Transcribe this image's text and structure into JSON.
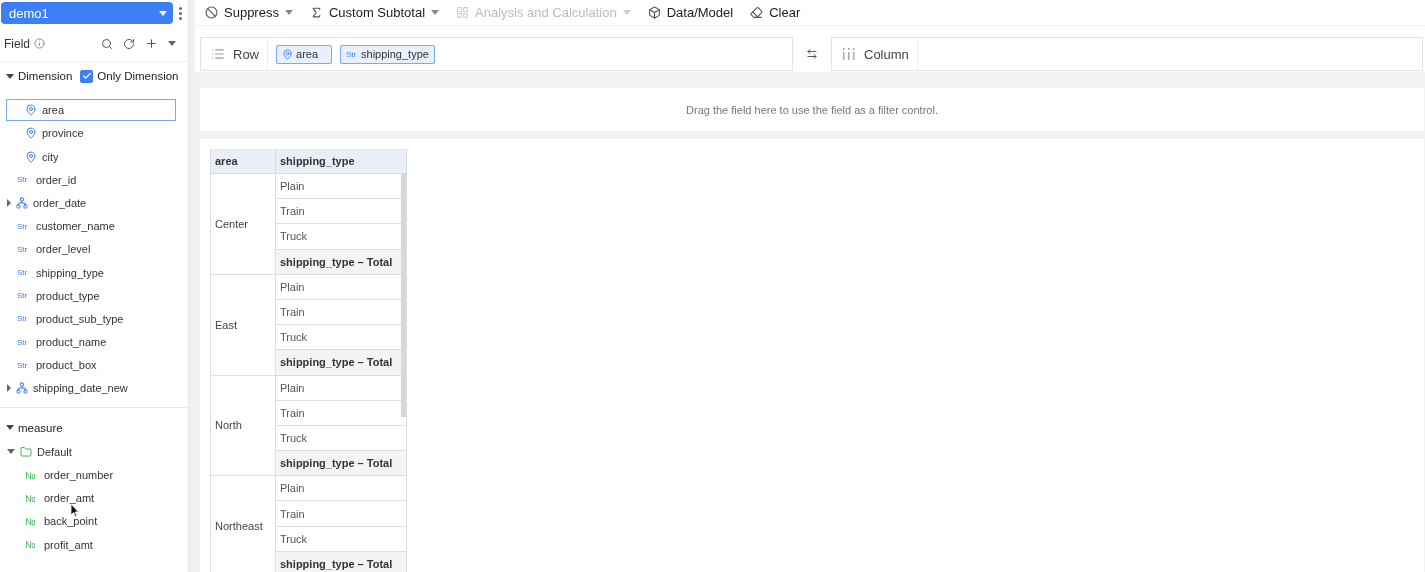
{
  "dataset": {
    "name": "demo1"
  },
  "field_panel": {
    "title": "Field",
    "dimension": {
      "label": "Dimension",
      "expanded": true,
      "only_dimension": {
        "label": "Only Dimension",
        "checked": true
      },
      "items": [
        {
          "kind": "geo",
          "label": "area",
          "selected": true
        },
        {
          "kind": "geo",
          "label": "province",
          "selected": false
        },
        {
          "kind": "geo",
          "label": "city",
          "selected": false
        },
        {
          "kind": "str",
          "badge": "Str",
          "label": "order_id",
          "selected": false
        },
        {
          "kind": "hierarchy",
          "label": "order_date",
          "expanded": false,
          "selected": false
        },
        {
          "kind": "str",
          "badge": "Str",
          "label": "customer_name",
          "selected": false
        },
        {
          "kind": "str",
          "badge": "Str",
          "label": "order_level",
          "selected": false
        },
        {
          "kind": "str",
          "badge": "Str",
          "label": "shipping_type",
          "selected": false
        },
        {
          "kind": "str",
          "badge": "Str",
          "label": "product_type",
          "selected": false
        },
        {
          "kind": "str",
          "badge": "Str",
          "label": "product_sub_type",
          "selected": false
        },
        {
          "kind": "str",
          "badge": "Str",
          "label": "product_name",
          "selected": false
        },
        {
          "kind": "str",
          "badge": "Str",
          "label": "product_box",
          "selected": false
        },
        {
          "kind": "hierarchy",
          "label": "shipping_date_new",
          "expanded": false,
          "selected": false
        }
      ]
    },
    "measure": {
      "label": "measure",
      "expanded": true,
      "groups": [
        {
          "label": "Default",
          "expanded": true,
          "children": [
            {
              "badge": "№",
              "label": "order_number"
            },
            {
              "badge": "№",
              "label": "order_amt"
            },
            {
              "badge": "№",
              "label": "back_point"
            },
            {
              "badge": "№",
              "label": "profit_amt"
            }
          ]
        }
      ]
    }
  },
  "toolbar": [
    {
      "label": "Suppress",
      "dropdown": true,
      "disabled": false
    },
    {
      "label": "Custom Subtotal",
      "dropdown": true,
      "disabled": false
    },
    {
      "label": "Analysis and Calculation",
      "dropdown": true,
      "disabled": true
    },
    {
      "label": "Data/Model",
      "dropdown": false,
      "disabled": false
    },
    {
      "label": "Clear",
      "dropdown": false,
      "disabled": false
    }
  ],
  "row_shelf": {
    "label": "Row",
    "pills": [
      {
        "kind": "geo",
        "label": "area"
      },
      {
        "kind": "str",
        "badge": "Str",
        "label": "shipping_type"
      }
    ]
  },
  "column_shelf": {
    "label": "Column"
  },
  "filter_area": {
    "hint": "Drag the field here to use the field as a filter control."
  },
  "table": {
    "columns": [
      "area",
      "shipping_type"
    ],
    "groups": [
      {
        "area": "Center",
        "rows": [
          {
            "kind": "value",
            "label": "Plain"
          },
          {
            "kind": "value",
            "label": "Train"
          },
          {
            "kind": "value",
            "label": "Truck"
          },
          {
            "kind": "total",
            "label": "shipping_type – Total"
          }
        ]
      },
      {
        "area": "East",
        "rows": [
          {
            "kind": "value",
            "label": "Plain"
          },
          {
            "kind": "value",
            "label": "Train"
          },
          {
            "kind": "value",
            "label": "Truck"
          },
          {
            "kind": "total",
            "label": "shipping_type – Total"
          }
        ]
      },
      {
        "area": "North",
        "rows": [
          {
            "kind": "value",
            "label": "Plain"
          },
          {
            "kind": "value",
            "label": "Train"
          },
          {
            "kind": "value",
            "label": "Truck"
          },
          {
            "kind": "total",
            "label": "shipping_type – Total"
          }
        ]
      },
      {
        "area": "Northeast",
        "rows": [
          {
            "kind": "value",
            "label": "Plain"
          },
          {
            "kind": "value",
            "label": "Train"
          },
          {
            "kind": "value",
            "label": "Truck"
          },
          {
            "kind": "total",
            "label": "shipping_type – Total"
          }
        ]
      }
    ]
  }
}
